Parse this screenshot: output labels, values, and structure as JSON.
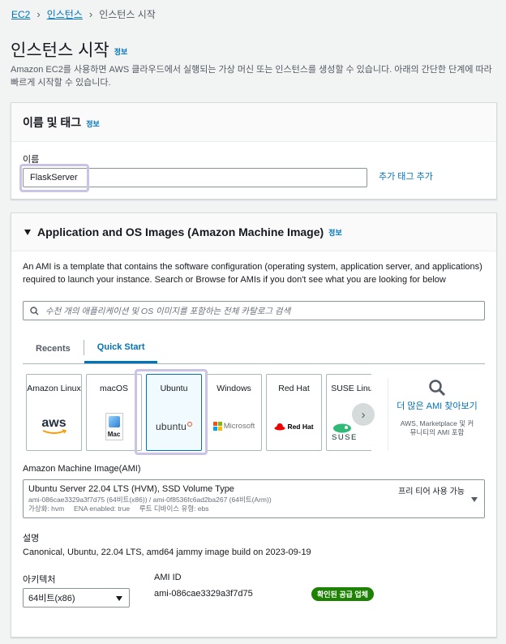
{
  "breadcrumb": {
    "ec2": "EC2",
    "instances": "인스턴스",
    "current": "인스턴스 시작"
  },
  "page": {
    "title": "인스턴스 시작",
    "info": "정보",
    "description": "Amazon EC2를 사용하면 AWS 클라우드에서 실행되는 가상 머신 또는 인스턴스를 생성할 수 있습니다. 아래의 간단한 단계에 따라 빠르게 시작할 수 있습니다."
  },
  "name_tags": {
    "title": "이름 및 태그",
    "info": "정보",
    "name_label": "이름",
    "name_value": "FlaskServer",
    "add_tags": "추가 태그 추가"
  },
  "ami": {
    "title": "Application and OS Images (Amazon Machine Image)",
    "info": "정보",
    "description": "An AMI is a template that contains the software configuration (operating system, application server, and applications) required to launch your instance. Search or Browse for AMIs if you don't see what you are looking for below",
    "search_placeholder": "수천 개의 애플리케이션 및 OS 이미지를 포함하는 전체 카탈로그 검색",
    "tabs": [
      "Recents",
      "Quick Start"
    ],
    "cards": [
      {
        "name": "Amazon Linux",
        "logo": "aws"
      },
      {
        "name": "macOS",
        "logo": "Mac"
      },
      {
        "name": "Ubuntu",
        "logo": "ubuntu"
      },
      {
        "name": "Windows",
        "logo": "Microsoft"
      },
      {
        "name": "Red Hat",
        "logo": "Red Hat"
      },
      {
        "name": "SUSE Linux",
        "logo": "SUSE"
      }
    ],
    "more": {
      "title": "더 많은 AMI 찾아보기",
      "subtitle": "AWS, Marketplace 및 커뮤니티의 AMI 포함"
    },
    "dropdown_label": "Amazon Machine Image(AMI)",
    "selected": {
      "name": "Ubuntu Server 22.04 LTS (HVM), SSD Volume Type",
      "ids": "ami-086cae3329a3f7d75 (64비트(x86)) / ami-0f8536fc6ad2ba267 (64비트(Arm))",
      "meta": "가상화: hvm     ENA enabled: true     루트 디바이스 유형: ebs",
      "free_tier": "프리 티어 사용 가능"
    },
    "desc_label": "설명",
    "desc_value": "Canonical, Ubuntu, 22.04 LTS, amd64 jammy image build on 2023-09-19",
    "arch_label": "아키텍처",
    "arch_value": "64비트(x86)",
    "ami_id_label": "AMI ID",
    "ami_id_value": "ami-086cae3329a3f7d75",
    "verified_badge": "확인된 공급 업체"
  },
  "colors": {
    "link": "#0073bb",
    "highlight": "#c9c3e6",
    "verified": "#1d8102",
    "ubuntu": "#e95420"
  }
}
